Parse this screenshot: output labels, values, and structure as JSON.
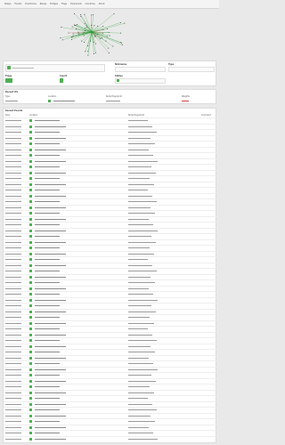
{
  "nav": [
    "Relays",
    "Events",
    "Directories",
    "Relays",
    "Bridges",
    "Flags",
    "Downloads",
    "Countries",
    "About"
  ],
  "summary": {
    "search_text": "",
    "nickname_label": "Nickname",
    "nickname_value": "",
    "type_label": "Type",
    "type_value": "",
    "flags_label": "Flags",
    "flags_value": "",
    "count_label": "Count",
    "count_value": "",
    "status_label": "Status",
    "status_value": "",
    "version_label": "Version",
    "version_value": ""
  },
  "section_small": {
    "title": "Recent IPs",
    "headers": [
      "Type",
      "Location",
      "Node fingerprint",
      "Weights"
    ],
    "row": {
      "id": "",
      "ip": "",
      "fingerprint": "",
      "weight": ""
    }
  },
  "section_main": {
    "title": "Recent Events",
    "headers": [
      "Type",
      "Location",
      "Node fingerprint",
      "Comment"
    ],
    "rows": 56
  },
  "colors": {
    "accent": "#4caf50",
    "edge_green": "#2e9e3a",
    "edge_red": "#d04040",
    "node": "#333333"
  }
}
